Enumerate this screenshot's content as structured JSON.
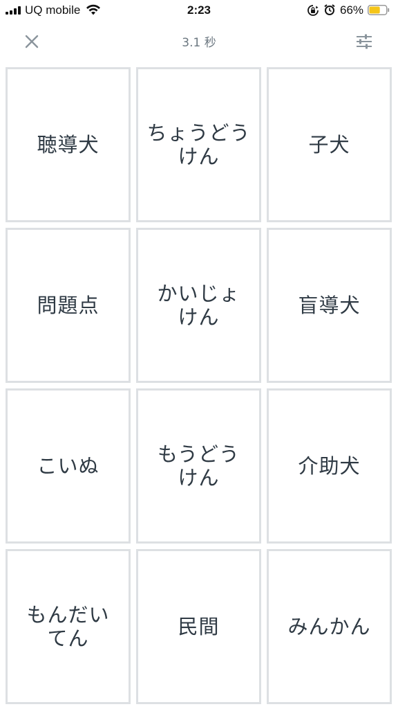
{
  "status_bar": {
    "carrier": "UQ mobile",
    "time": "2:23",
    "battery_percent": "66%",
    "battery_level": 0.66,
    "battery_color": "#f5c518",
    "icons": [
      "signal-icon",
      "wifi-icon",
      "rotation-lock-icon",
      "alarm-icon",
      "battery-icon"
    ]
  },
  "header": {
    "close_icon": "close-icon",
    "timer": "3.1 秒",
    "settings_icon": "sliders-icon"
  },
  "cards": [
    {
      "label": "聴導犬"
    },
    {
      "label": "ちょうどう\nけん"
    },
    {
      "label": "子犬"
    },
    {
      "label": "問題点"
    },
    {
      "label": "かいじょ\nけん"
    },
    {
      "label": "盲導犬"
    },
    {
      "label": "こいぬ"
    },
    {
      "label": "もうどう\nけん"
    },
    {
      "label": "介助犬"
    },
    {
      "label": "もんだい\nてん"
    },
    {
      "label": "民間"
    },
    {
      "label": "みんかん"
    }
  ],
  "colors": {
    "card_border": "#dde0e3",
    "text": "#2f3a44",
    "icon_gray": "#8a949c"
  }
}
